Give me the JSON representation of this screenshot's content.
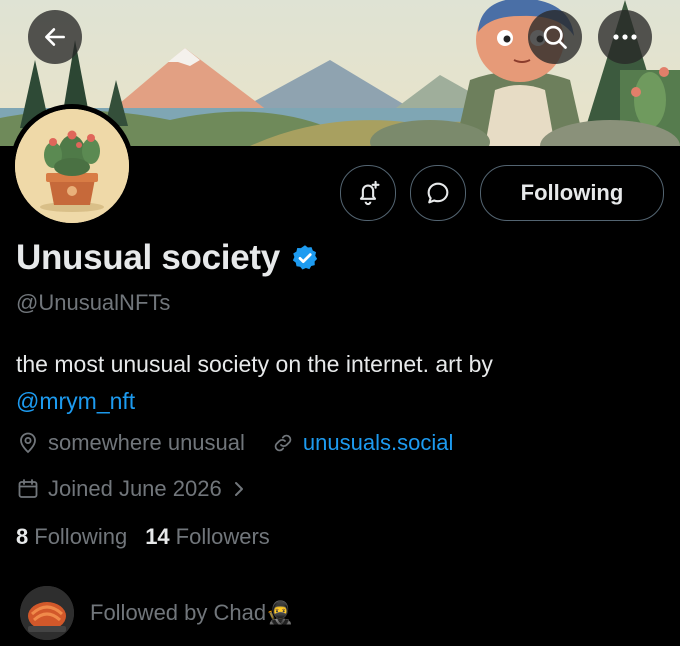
{
  "profile": {
    "name": "Unusual society",
    "handle": "@UnusualNFTs",
    "bio_text": "the most unusual society on the internet. art by",
    "bio_mention": "@mrym_nft",
    "location": "somewhere unusual",
    "website": "unusuals.social",
    "joined": "Joined June 2026",
    "following_count": "8",
    "following_label": "Following",
    "followers_count": "14",
    "followers_label": "Followers",
    "followed_by": "Followed by Chad",
    "followed_by_emoji": "🥷"
  },
  "actions": {
    "follow_state_label": "Following"
  },
  "icons": {
    "back": "arrow-left-icon",
    "search": "search-icon",
    "more": "more-icon",
    "notify": "bell-plus-icon",
    "message": "message-bubble-icon",
    "location": "location-pin-icon",
    "link": "link-icon",
    "calendar": "calendar-icon",
    "chevron": "chevron-right-icon",
    "verified": "verified-badge-icon"
  },
  "colors": {
    "background": "#000000",
    "primary_text": "#e7e9ea",
    "secondary_text": "#71767b",
    "link": "#1d9bf0",
    "border": "#536471"
  }
}
